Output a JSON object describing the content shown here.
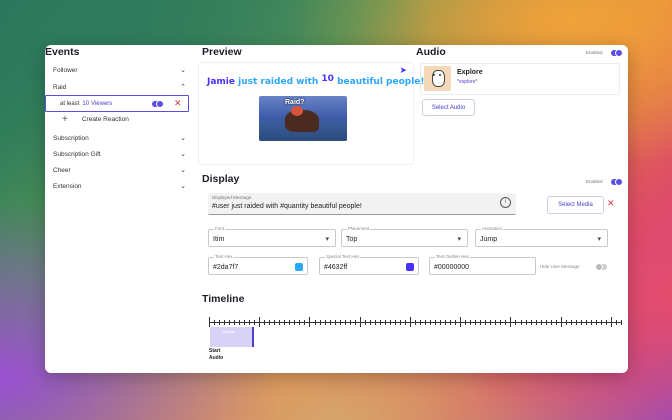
{
  "events": {
    "title": "Events",
    "items": [
      {
        "label": "Follower",
        "expanded": false
      },
      {
        "label": "Raid",
        "expanded": true
      },
      {
        "label": "Subscription",
        "expanded": false
      },
      {
        "label": "Subscription Gift",
        "expanded": false
      },
      {
        "label": "Cheer",
        "expanded": false
      },
      {
        "label": "Extension",
        "expanded": false
      }
    ],
    "raid_condition": {
      "prefix": "at least",
      "count": "10",
      "unit": "Viewers",
      "enabled": true
    },
    "create_reaction": "Create Reaction",
    "plus_symbol": "+"
  },
  "preview": {
    "title": "Preview",
    "text_name": "Jamie",
    "text_middle": "just raided with",
    "text_count": "10",
    "text_end": "beautiful people!",
    "image_caption": "Raid?",
    "accent_color": "#4632ff",
    "text_color": "#2da7f7"
  },
  "audio": {
    "title": "Audio",
    "enabled_label": "Enabled",
    "enabled": true,
    "track_name": "Explore",
    "track_file": "*explore*",
    "select_button": "Select Audio"
  },
  "display": {
    "title": "Display",
    "enabled_label": "Enabled",
    "enabled": true,
    "message_label": "Displayed Message",
    "message_value": "#user just raided with #quantity beautiful people!",
    "select_media": "Select Media",
    "font_label": "Font",
    "font_value": "Itim",
    "placement_label": "Placement",
    "placement_value": "Top",
    "animation_label": "Animation",
    "animation_value": "Jump",
    "text_hex_label": "Text Hex",
    "text_hex_value": "#2da7f7",
    "text_hex_color": "#2da7f7",
    "special_hex_label": "Special Text Hex",
    "special_hex_value": "#4632ff",
    "special_hex_color": "#4632ff",
    "outline_hex_label": "Text Outline Hex",
    "outline_hex_value": "#00000000",
    "hide_label": "Hide User Message",
    "hide_enabled": false
  },
  "timeline": {
    "title": "Timeline",
    "clip_label": "Display",
    "audio_label_1": "Start",
    "audio_label_2": "Audio"
  }
}
